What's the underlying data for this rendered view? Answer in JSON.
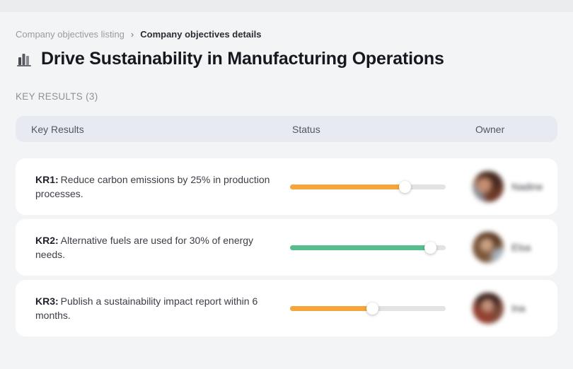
{
  "breadcrumb": {
    "items": [
      {
        "label": "Company objectives listing"
      },
      {
        "label": "Company objectives details"
      }
    ],
    "separator": "›"
  },
  "header": {
    "icon": "bar-chart-icon",
    "title": "Drive Sustainability in Manufacturing Operations"
  },
  "section": {
    "label": "KEY RESULTS (3)"
  },
  "table": {
    "columns": [
      {
        "label": "Key Results"
      },
      {
        "label": "Status"
      },
      {
        "label": "Owner"
      }
    ],
    "rows": [
      {
        "kr_label": "KR1:",
        "kr_text": "Reduce carbon emissions by 25% in production processes.",
        "progress_percent": 74,
        "progress_color": "#F8A43D",
        "owner_name": "Nadine"
      },
      {
        "kr_label": "KR2:",
        "kr_text": "Alternative fuels are used for 30% of energy needs.",
        "progress_percent": 90,
        "progress_color": "#55BE8C",
        "owner_name": "Elsa"
      },
      {
        "kr_label": "KR3:",
        "kr_text": "Publish a sustainability impact report within 6 months.",
        "progress_percent": 53,
        "progress_color": "#F8A43D",
        "owner_name": "Ina"
      }
    ]
  },
  "colors": {
    "page_background": "#F3F4F6",
    "card_background": "#FFFFFF",
    "table_header_background": "#E7EAF1",
    "progress_track": "#E3E3E6",
    "progress_orange": "#F8A43D",
    "progress_green": "#55BE8C"
  }
}
